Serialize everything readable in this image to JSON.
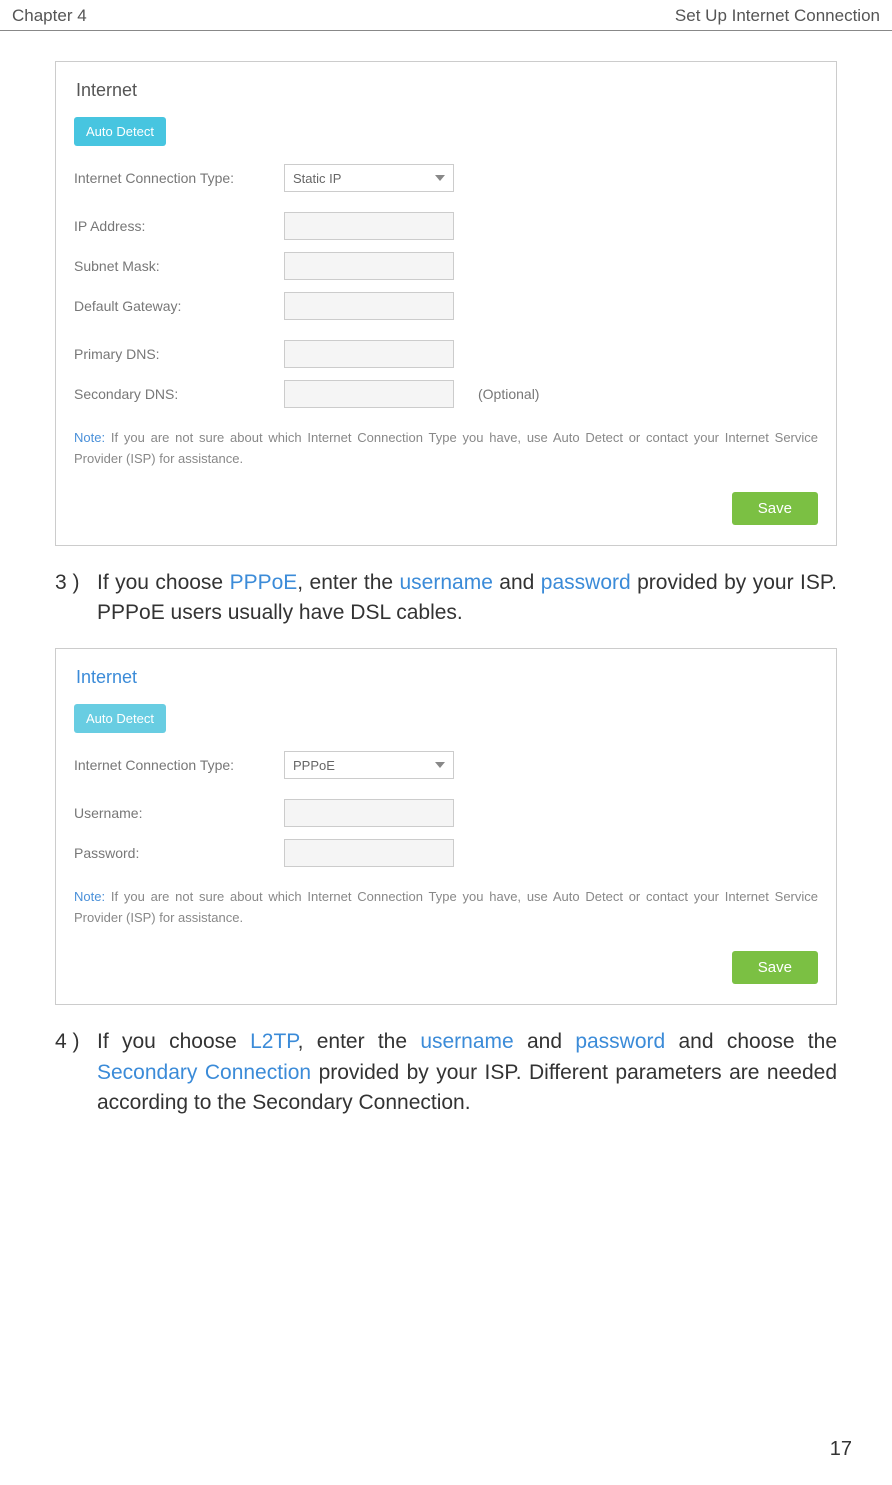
{
  "header": {
    "chapter": "Chapter 4",
    "title": "Set Up Internet Connection"
  },
  "panel1": {
    "title": "Internet",
    "auto_detect": "Auto Detect",
    "conn_type_label": "Internet Connection Type:",
    "conn_type_value": "Static IP",
    "ip_label": "IP Address:",
    "subnet_label": "Subnet Mask:",
    "gateway_label": "Default Gateway:",
    "primary_dns_label": "Primary DNS:",
    "secondary_dns_label": "Secondary DNS:",
    "optional": "(Optional)",
    "note_label": "Note:",
    "note_text": " If you are not sure about which Internet Connection Type you have, use Auto Detect or contact your Internet Service Provider (ISP) for assistance.",
    "save": "Save"
  },
  "step3": {
    "num": "3 )",
    "t1": "If you choose ",
    "pppoe": "PPPoE",
    "t2": ", enter the ",
    "username": "username",
    "t3": " and ",
    "password": "password",
    "t4": " provided by your ISP. PPPoE users usually have DSL cables."
  },
  "panel2": {
    "title": "Internet",
    "auto_detect": "Auto Detect",
    "conn_type_label": "Internet Connection Type:",
    "conn_type_value": "PPPoE",
    "username_label": "Username:",
    "password_label": "Password:",
    "note_label": "Note:",
    "note_text": " If you are not sure about which Internet Connection Type you have, use Auto Detect or contact your Internet Service Provider (ISP) for assistance.",
    "save": "Save"
  },
  "step4": {
    "num": "4 )",
    "t1": "If you choose ",
    "l2tp": "L2TP",
    "t2": ", enter the ",
    "username": "username",
    "t3": " and ",
    "password": "password",
    "t4": " and choose the ",
    "secondary_conn": "Secondary Connection",
    "t5": " provided by your ISP. Different parameters are needed according to the Secondary Connection."
  },
  "page_number": "17"
}
